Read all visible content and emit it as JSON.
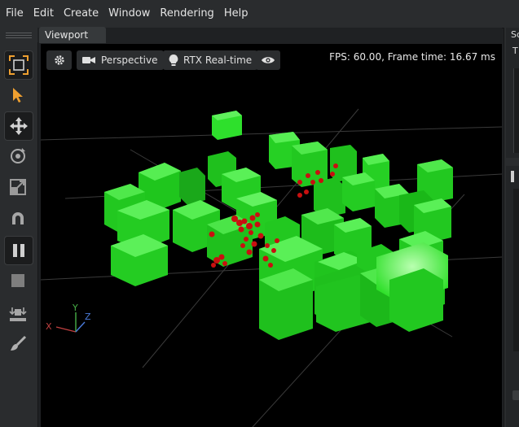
{
  "menu": [
    "File",
    "Edit",
    "Create",
    "Window",
    "Rendering",
    "Help"
  ],
  "tab": {
    "label": "Viewport"
  },
  "viewport": {
    "camera_label": "Perspective",
    "render_label": "RTX Real-time",
    "fps_text": "FPS: 60.00, Frame time: 16.67 ms",
    "axis": {
      "x": "X",
      "y": "Y",
      "z": "Z"
    }
  },
  "right_panel": {
    "tab_fragment": "Sc",
    "label_fragment": "T"
  },
  "colors": {
    "accent": "#f0a030",
    "cube": "#1fd81f",
    "particle": "#cc1010"
  }
}
